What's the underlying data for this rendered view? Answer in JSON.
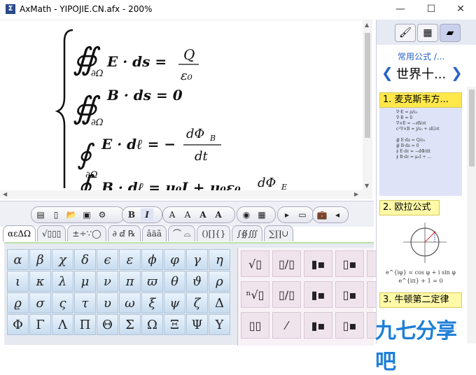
{
  "window": {
    "title": "AxMath - YIPOJIE.CN.afx - 200%",
    "min": "—",
    "max": "☐",
    "close": "✕"
  },
  "toolbar": {
    "bold": "B",
    "italic": "I",
    "font_a1": "A",
    "font_a2": "A",
    "font_a3": "A",
    "font_a4": "A"
  },
  "tabs": [
    "αεΔΩ",
    "√▯▯▯",
    "±÷∵◯",
    "∂ ⅆ ℞",
    "âäã",
    "⌒ ⌓",
    "()[]{}",
    "∫∯∭",
    "∑∏∪"
  ],
  "greek_rows": [
    [
      "α",
      "β",
      "χ",
      "δ",
      "ϵ",
      "ε",
      "ϕ",
      "φ",
      "γ",
      "η"
    ],
    [
      "ι",
      "κ",
      "λ",
      "μ",
      "ν",
      "π",
      "ϖ",
      "θ",
      "ϑ",
      "ρ"
    ],
    [
      "ϱ",
      "σ",
      "ς",
      "τ",
      "υ",
      "ω",
      "ξ",
      "ψ",
      "ζ",
      "Δ"
    ],
    [
      "Φ",
      "Γ",
      "Λ",
      "Π",
      "Θ",
      "Σ",
      "Ω",
      "Ξ",
      "Ψ",
      "Υ"
    ]
  ],
  "frac_cells": [
    "√▯",
    "▯/▯",
    "▮▪",
    "▯▪",
    "▪",
    "ⁿ√▯",
    "▯/▯",
    "▮▪",
    "▯▪",
    "▪",
    "▯▯",
    "⁄",
    "▮▪",
    "▯▪",
    "▪"
  ],
  "editor": {
    "eq1_lhs": "∯",
    "eq1_sub": "∂Ω",
    "eq1_body": "E · ds =",
    "eq1_num": "Q",
    "eq1_den": "ε₀",
    "eq2_body": "B · ds = 0",
    "eq3_body": "E · dℓ = −",
    "eq3_num": "dΦ",
    "eq3_num_sub": "B",
    "eq3_den": "dt",
    "eq4_num": "dΦ",
    "eq4_num_sub": "E"
  },
  "right_panel": {
    "crumb": "常用公式 /...",
    "category": "世界十...",
    "items": [
      {
        "label": "1. 麦克斯韦方...",
        "active": true
      },
      {
        "label": "2. 欧拉公式",
        "active": false
      },
      {
        "label": "3. 牛顿第二定律",
        "active": false
      }
    ],
    "euler_line1": "e^{iφ} = cos φ + i sin φ",
    "euler_line2": "e^{iπ} + 1 = 0"
  },
  "watermark": "九七分享吧"
}
